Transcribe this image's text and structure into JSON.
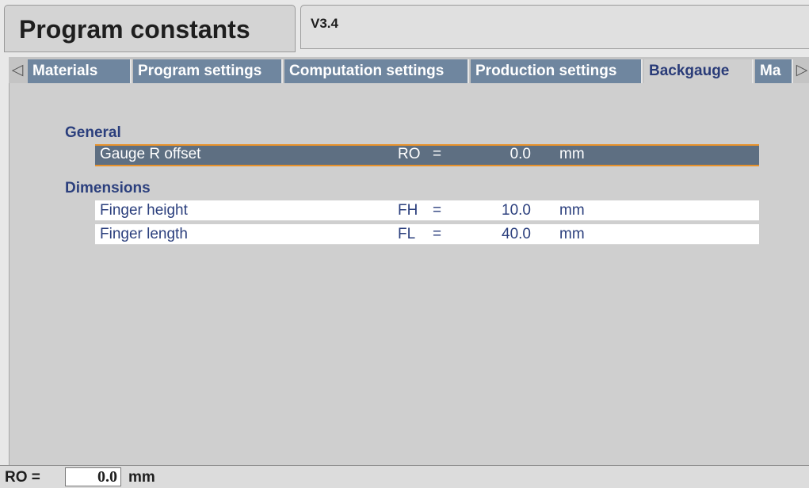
{
  "header": {
    "title": "Program constants",
    "version": "V3.4"
  },
  "tabs": {
    "left_arrow_icon": "triangle-left-icon",
    "right_arrow_icon": "triangle-right-icon",
    "items": [
      {
        "label": "Materials",
        "active": false
      },
      {
        "label": "Program settings",
        "active": false
      },
      {
        "label": "Computation settings",
        "active": false
      },
      {
        "label": "Production settings",
        "active": false
      },
      {
        "label": "Backgauge",
        "active": true
      },
      {
        "label": "Ma",
        "active": false
      }
    ]
  },
  "sections": [
    {
      "title": "General",
      "rows": [
        {
          "label": "Gauge R offset",
          "symbol": "RO",
          "eq": "=",
          "value": "0.0",
          "unit": "mm",
          "selected": true
        }
      ]
    },
    {
      "title": "Dimensions",
      "rows": [
        {
          "label": "Finger height",
          "symbol": "FH",
          "eq": "=",
          "value": "10.0",
          "unit": "mm",
          "selected": false
        },
        {
          "label": "Finger length",
          "symbol": "FL",
          "eq": "=",
          "value": "40.0",
          "unit": "mm",
          "selected": false
        }
      ]
    }
  ],
  "statusbar": {
    "symbol": "RO =",
    "value": "0.0",
    "unit": "mm"
  },
  "colors": {
    "tab_inactive": "#6f869f",
    "tab_active_text": "#293b78",
    "selection_bg": "#5e6f82",
    "selection_border": "#e8922b",
    "section_text": "#2b3f7d"
  }
}
